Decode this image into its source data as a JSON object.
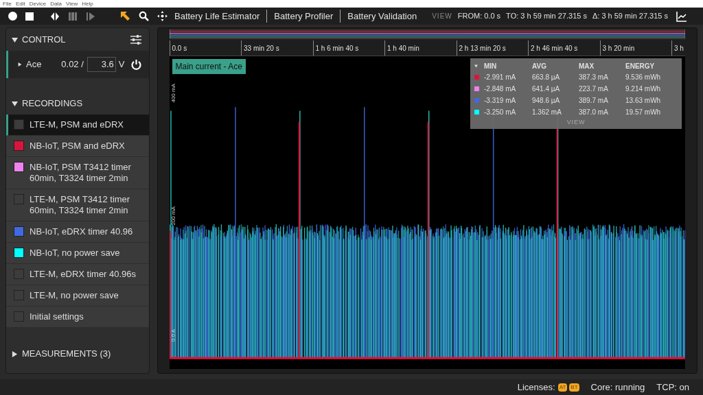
{
  "menu": [
    "File",
    "Edit",
    "Device",
    "Data",
    "View",
    "Help"
  ],
  "nav_tabs": [
    "Battery Life Estimator",
    "Battery Profiler",
    "Battery Validation"
  ],
  "view": {
    "label": "VIEW",
    "from": "FROM: 0.0 s",
    "to": "TO: 3 h 59 min 27.315 s",
    "delta": "Δ: 3 h 59 min 27.315 s"
  },
  "control": {
    "title": "CONTROL",
    "device": "Ace",
    "current": "0.02 /",
    "voltage": "3.6",
    "unit": "V"
  },
  "recordings": {
    "title": "RECORDINGS",
    "items": [
      {
        "label": "LTE-M, PSM and eDRX",
        "color": "#3c3c3c",
        "selected": true
      },
      {
        "label": "NB-IoT, PSM and eDRX",
        "color": "#dc143c",
        "selected": false
      },
      {
        "label": "NB-IoT, PSM T3412 timer 60min, T3324 timer 2min",
        "color": "#ee82ee",
        "selected": false
      },
      {
        "label": "LTE-M, PSM T3412 timer 60min, T3324 timer 2min",
        "color": "#3c3c3c",
        "selected": false
      },
      {
        "label": "NB-IoT, eDRX timer 40.96",
        "color": "#4169e1",
        "selected": false
      },
      {
        "label": "NB-IoT, no power save",
        "color": "#00ffff",
        "selected": false
      },
      {
        "label": "LTE-M, eDRX timer 40.96s",
        "color": "#3c3c3c",
        "selected": false
      },
      {
        "label": "LTE-M, no power save",
        "color": "#3c3c3c",
        "selected": false
      },
      {
        "label": "Initial settings",
        "color": "#3c3c3c",
        "selected": false
      }
    ]
  },
  "measurements": {
    "title": "MEASUREMENTS (3)",
    "expanded": false
  },
  "time_axis": [
    "0.0 s",
    "33 min 20 s",
    "1 h 6 min 40 s",
    "1 h 40 min",
    "2 h 13 min 20 s",
    "2 h 46 min 40 s",
    "3 h 20 min",
    "3 h"
  ],
  "y_axis": [
    "400 mA",
    "200 mA",
    "0.0 A"
  ],
  "trace_label": "Main current - Ace",
  "stats": {
    "columns": [
      "MIN",
      "AVG",
      "MAX",
      "ENERGY"
    ],
    "footer": "VIEW",
    "rows": [
      {
        "color": "#dc143c",
        "values": [
          "-2.991 mA",
          "663.8 µA",
          "387.3 mA",
          "9.536 mWh"
        ]
      },
      {
        "color": "#ee82ee",
        "values": [
          "-2.848 mA",
          "641.4 µA",
          "223.7 mA",
          "9.214 mWh"
        ]
      },
      {
        "color": "#4169e1",
        "values": [
          "-3.319 mA",
          "948.6 µA",
          "389.7 mA",
          "13.63 mWh"
        ]
      },
      {
        "color": "#00ffff",
        "values": [
          "-3.250 mA",
          "1.362 mA",
          "387.0 mA",
          "19.57 mWh"
        ]
      }
    ]
  },
  "status": {
    "licenses": "Licenses:",
    "badges": [
      "AT",
      "BT"
    ],
    "core": "Core: running",
    "tcp": "TCP: on"
  }
}
